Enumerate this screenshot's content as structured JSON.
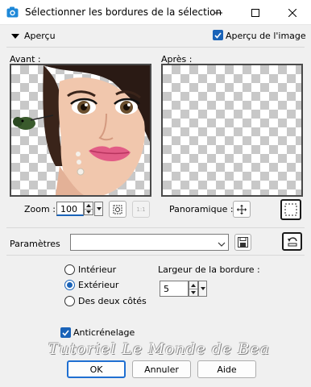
{
  "window": {
    "title": "Sélectionner les bordures de la sélection"
  },
  "preview": {
    "section_label": "Aperçu",
    "apercu_image_label": "Aperçu de l'image",
    "before_label": "Avant :",
    "after_label": "Après :",
    "zoom_label": "Zoom :",
    "zoom_value": "100",
    "pan_label": "Panoramique :",
    "zoom_1to1_text": "1:1"
  },
  "params": {
    "label": "Paramètres",
    "preset_value": ""
  },
  "options": {
    "interior_label": "Intérieur",
    "exterior_label": "Extérieur",
    "both_sides_label": "Des deux côtés",
    "selected": "exterior",
    "border_width_label": "Largeur de la bordure :",
    "border_width_value": "5",
    "antialias_label": "Anticrénelage",
    "antialias_checked": true
  },
  "watermark": "Tutoriel Le Monde de Bea",
  "buttons": {
    "ok": "OK",
    "cancel": "Annuler",
    "help": "Aide"
  },
  "colors": {
    "accent": "#1a63b8",
    "ok_border": "#1f6fd1"
  }
}
